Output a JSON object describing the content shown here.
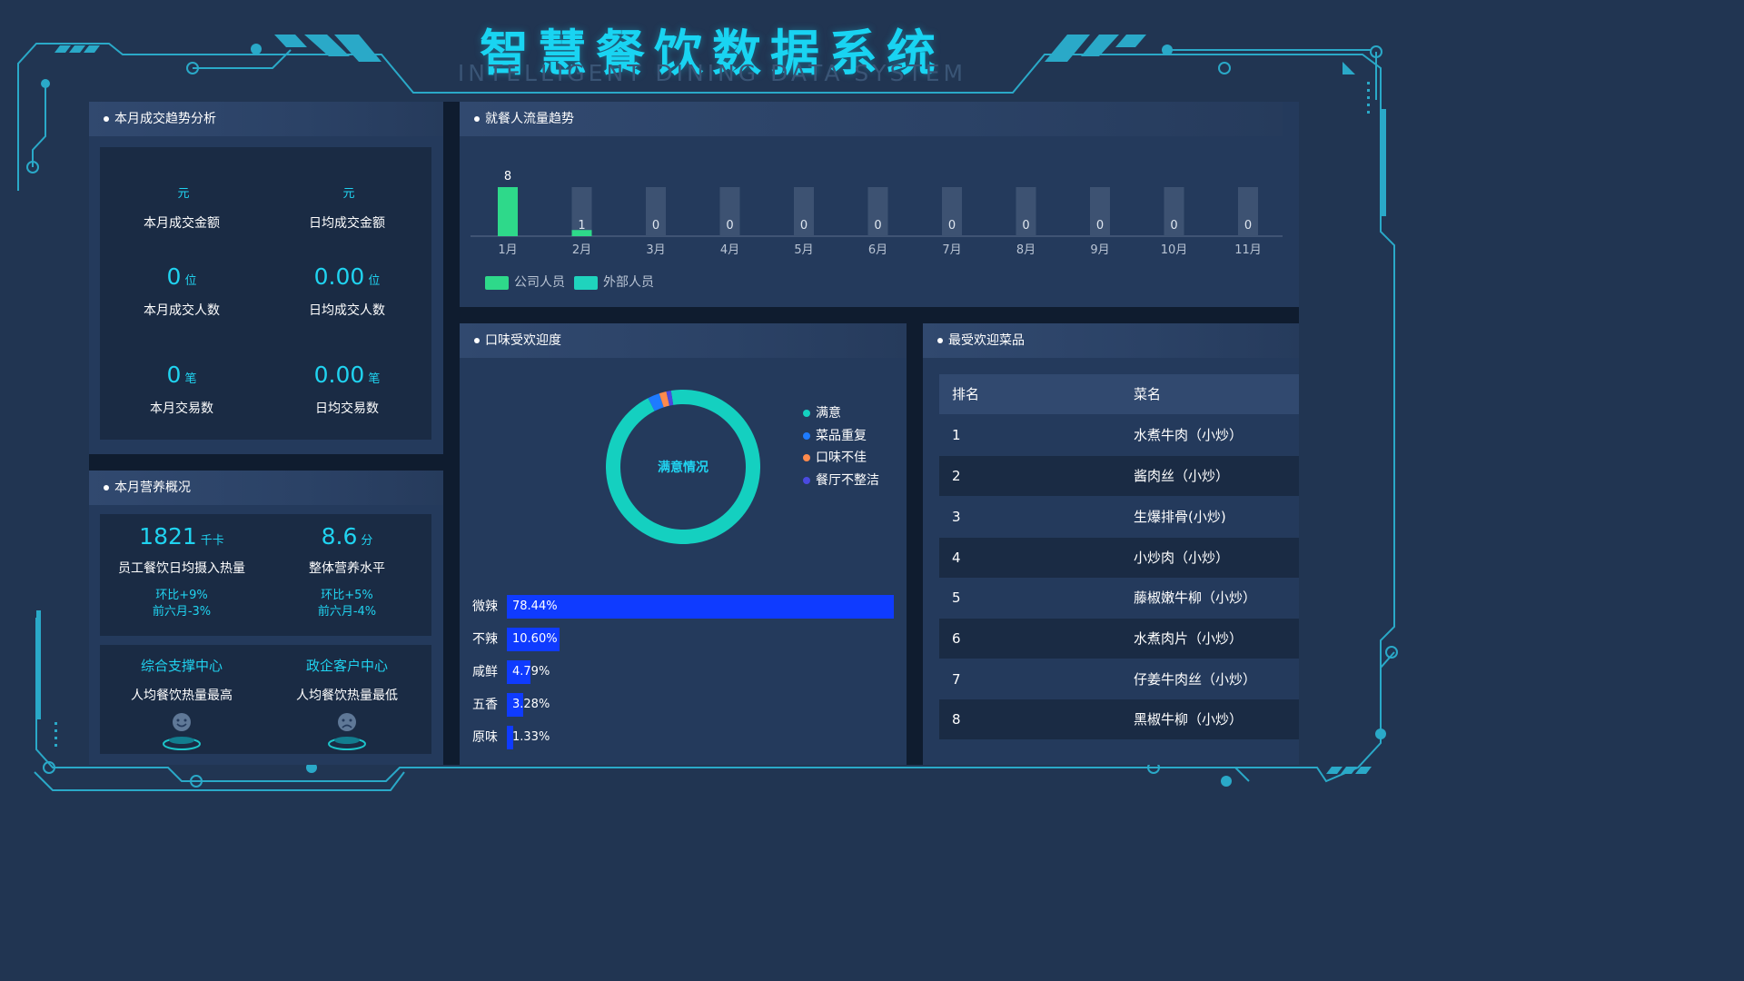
{
  "header": {
    "title": "智慧餐饮数据系统",
    "subtitle": "INTELLIGENT DINING DATA SYSTEM"
  },
  "colors": {
    "accent": "#19d4f2",
    "frame": "#2aa9c8",
    "company_staff": "#2ed98a",
    "external_staff": "#1fd3bd",
    "bar_blue": "#0f3bff"
  },
  "monthly_trend": {
    "title": "本月成交趋势分析",
    "kpis": [
      {
        "value": "",
        "unit": "元",
        "label": "本月成交金额"
      },
      {
        "value": "",
        "unit": "元",
        "label": "日均成交金额"
      },
      {
        "value": "0",
        "unit": "位",
        "label": "本月成交人数"
      },
      {
        "value": "0.00",
        "unit": "位",
        "label": "日均成交人数"
      },
      {
        "value": "0",
        "unit": "笔",
        "label": "本月交易数"
      },
      {
        "value": "0.00",
        "unit": "笔",
        "label": "日均交易数"
      }
    ]
  },
  "nutrition": {
    "title": "本月营养概况",
    "kpis": [
      {
        "value": "1821",
        "unit": "千卡",
        "label": "员工餐饮日均摄入热量",
        "mom": "环比+9%",
        "six": "前六月-3%"
      },
      {
        "value": "8.6",
        "unit": "分",
        "label": "整体营养水平",
        "mom": "环比+5%",
        "six": "前六月-4%"
      }
    ],
    "centers": [
      {
        "name": "综合支撑中心",
        "desc": "人均餐饮热量最高",
        "icon": "smile-face-icon"
      },
      {
        "name": "政企客户中心",
        "desc": "人均餐饮热量最低",
        "icon": "sad-face-icon"
      }
    ]
  },
  "flow": {
    "title": "就餐人流量趋势",
    "legend": [
      "公司人员",
      "外部人员"
    ]
  },
  "chart_data": [
    {
      "type": "bar",
      "categories": [
        "1月",
        "2月",
        "3月",
        "4月",
        "5月",
        "6月",
        "7月",
        "8月",
        "9月",
        "10月",
        "11月"
      ],
      "values": [
        8,
        1,
        0,
        0,
        0,
        0,
        0,
        0,
        0,
        0,
        0
      ],
      "max": 8
    },
    {
      "type": "pie",
      "center_label": "满意情况",
      "labels": [
        "满意",
        "菜品重复",
        "口味不佳",
        "餐厅不整洁"
      ],
      "values": [
        95,
        2.5,
        1.5,
        1
      ],
      "colors": [
        "#14d0c0",
        "#1e7bff",
        "#ff8a4c",
        "#4a4adf"
      ]
    },
    {
      "type": "bar",
      "orientation": "horizontal",
      "categories": [
        "微辣",
        "不辣",
        "咸鲜",
        "五香",
        "原味"
      ],
      "values": [
        78.44,
        10.6,
        4.79,
        3.28,
        1.33
      ],
      "labels": [
        "78.44%",
        "10.60%",
        "4.79%",
        "3.28%",
        "1.33%"
      ]
    }
  ],
  "taste": {
    "title": "口味受欢迎度"
  },
  "dishes": {
    "title": "最受欢迎菜品",
    "headers": [
      "排名",
      "菜名"
    ],
    "rows": [
      {
        "rank": "1",
        "name": "水煮牛肉（小炒）"
      },
      {
        "rank": "2",
        "name": "酱肉丝（小炒）"
      },
      {
        "rank": "3",
        "name": "生爆排骨(小炒)"
      },
      {
        "rank": "4",
        "name": "小炒肉（小炒）"
      },
      {
        "rank": "5",
        "name": "藤椒嫩牛柳（小炒）"
      },
      {
        "rank": "6",
        "name": "水煮肉片（小炒）"
      },
      {
        "rank": "7",
        "name": "仔姜牛肉丝（小炒）"
      },
      {
        "rank": "8",
        "name": "黑椒牛柳（小炒）"
      }
    ]
  }
}
